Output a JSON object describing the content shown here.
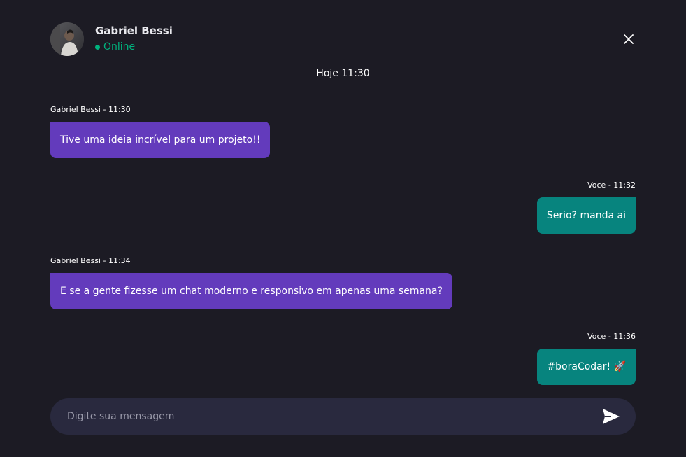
{
  "header": {
    "contact_name": "Gabriel Bessi",
    "status": "Online",
    "status_color": "#00b37e",
    "avatar_icon": "user-avatar",
    "close_icon": "close-icon"
  },
  "date_separator": "Hoje 11:30",
  "messages": [
    {
      "sender": "Gabriel Bessi",
      "time": "11:30",
      "meta": "Gabriel Bessi - 11:30",
      "text": "Tive uma ideia incrível para um projeto!!",
      "direction": "in"
    },
    {
      "sender": "Voce",
      "time": "11:32",
      "meta": "Voce - 11:32",
      "text": "Serio? manda ai",
      "direction": "out"
    },
    {
      "sender": "Gabriel Bessi",
      "time": "11:34",
      "meta": "Gabriel Bessi - 11:34",
      "text": "E se a gente fizesse um chat moderno e responsivo em apenas uma semana?",
      "direction": "in"
    },
    {
      "sender": "Voce",
      "time": "11:36",
      "meta": "Voce - 11:36",
      "text": "#boraCodar! 🚀",
      "direction": "out"
    }
  ],
  "composer": {
    "placeholder": "Digite sua mensagem",
    "value": "",
    "send_icon": "send-icon"
  },
  "colors": {
    "background": "#1c1b24",
    "incoming_bubble": "#633bbc",
    "outgoing_bubble": "#07847e",
    "input_background": "#29293e"
  }
}
